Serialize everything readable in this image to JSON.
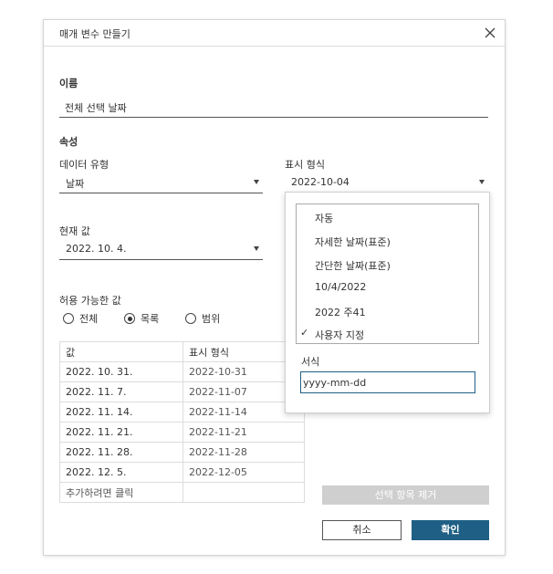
{
  "dialog": {
    "title": "매개 변수 만들기"
  },
  "name_section": {
    "label": "이름",
    "value": "전체 선택 날짜"
  },
  "properties": {
    "label": "속성",
    "data_type_label": "데이터 유형",
    "data_type_value": "날짜",
    "display_format_label": "표시 형식",
    "display_format_value": "2022-10-04",
    "current_value_label": "현재 값",
    "current_value": "2022. 10. 4."
  },
  "allowed_values": {
    "label": "허용 가능한 값",
    "options": [
      "전체",
      "목록",
      "범위"
    ],
    "selected": "목록"
  },
  "value_table": {
    "headers": [
      "값",
      "표시 형식"
    ],
    "rows": [
      [
        "2022. 10. 31.",
        "2022-10-31"
      ],
      [
        "2022. 11. 7.",
        "2022-11-07"
      ],
      [
        "2022. 11. 14.",
        "2022-11-14"
      ],
      [
        "2022. 11. 21.",
        "2022-11-21"
      ],
      [
        "2022. 11. 28.",
        "2022-11-28"
      ],
      [
        "2022. 12. 5.",
        "2022-12-05"
      ]
    ],
    "add_row_label": "추가하려면 클릭"
  },
  "buttons": {
    "remove_selected": "선택 항목 제거",
    "cancel": "취소",
    "ok": "확인"
  },
  "format_popup": {
    "options": [
      "자동",
      "자세한 날짜(표준)",
      "간단한 날짜(표준)",
      "10/4/2022",
      "2022 주41",
      "사용자 지정"
    ],
    "checked": "사용자 지정",
    "checkmark": "✓",
    "format_label": "서식",
    "format_value": "yyyy-mm-dd"
  },
  "icons": {
    "close": "close-icon",
    "dropdown": "chevron-down-icon"
  },
  "colors": {
    "primary": "#1f5f85",
    "disabled": "#cfcfcf"
  }
}
